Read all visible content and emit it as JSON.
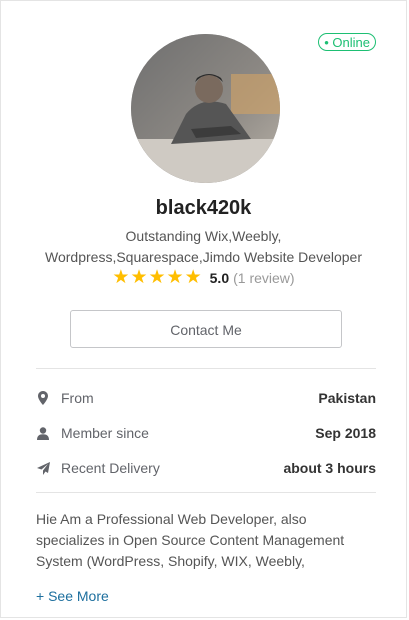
{
  "profile": {
    "status": "• Online",
    "username": "black420k",
    "tagline": "Outstanding Wix,Weebly, Wordpress,Squarespace,Jimdo Website Developer",
    "rating": {
      "stars": 5,
      "score": "5.0",
      "reviews": "(1 review)"
    },
    "contact_button": "Contact Me"
  },
  "stats": [
    {
      "icon": "location-pin-icon",
      "label": "From",
      "value": "Pakistan"
    },
    {
      "icon": "user-icon",
      "label": "Member since",
      "value": "Sep 2018"
    },
    {
      "icon": "paper-plane-icon",
      "label": "Recent Delivery",
      "value": "about 3 hours"
    }
  ],
  "description": "Hie Am a Professional Web Developer, also specializes in Open Source Content Management System (WordPress, Shopify, WIX, Weebly,",
  "see_more": "+ See More",
  "colors": {
    "online": "#1dbf73",
    "star": "#ffbe00",
    "link": "#1d6f9e"
  }
}
